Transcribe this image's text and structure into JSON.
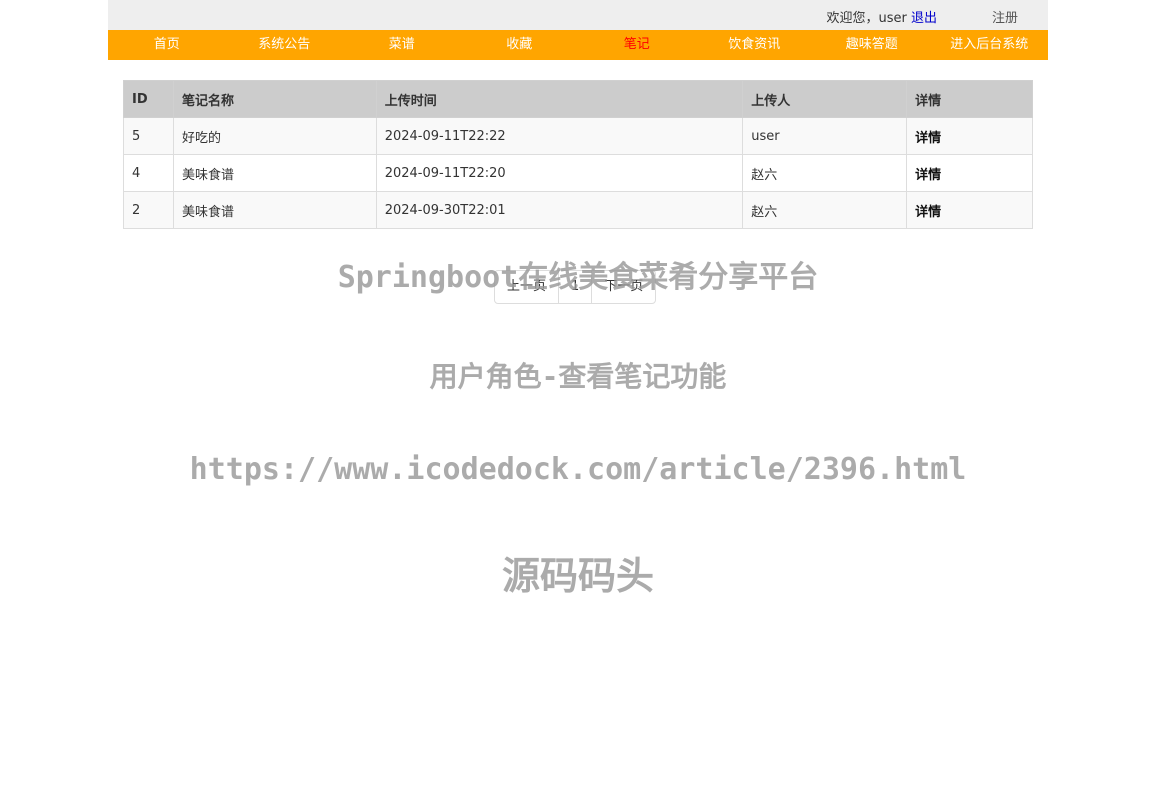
{
  "header": {
    "welcome_text": "欢迎您，user",
    "logout_label": "退出",
    "register_label": "注册"
  },
  "nav": {
    "items": [
      {
        "label": "首页"
      },
      {
        "label": "系统公告"
      },
      {
        "label": "菜谱"
      },
      {
        "label": "收藏"
      },
      {
        "label": "笔记"
      },
      {
        "label": "饮食资讯"
      },
      {
        "label": "趣味答题"
      },
      {
        "label": "进入后台系统"
      }
    ],
    "active_color": "#ff0000",
    "bar_color": "#ffa500"
  },
  "table": {
    "headers": [
      "ID",
      "笔记名称",
      "上传时间",
      "上传人",
      "详情"
    ],
    "rows": [
      {
        "id": "5",
        "name": "好吃的",
        "time": "2024-09-11T22:22",
        "uploader": "user",
        "detail": "详情"
      },
      {
        "id": "4",
        "name": "美味食谱",
        "time": "2024-09-11T22:20",
        "uploader": "赵六",
        "detail": "详情"
      },
      {
        "id": "2",
        "name": "美味食谱",
        "time": "2024-09-30T22:01",
        "uploader": "赵六",
        "detail": "详情"
      }
    ]
  },
  "pagination": {
    "prev_label": "上一页",
    "current_page": "1",
    "next_label": "下一页"
  },
  "watermark": {
    "line1": "Springboot在线美食菜肴分享平台",
    "line2": "用户角色-查看笔记功能",
    "line3": "https://www.icodedock.com/article/2396.html",
    "line4": "源码码头"
  }
}
